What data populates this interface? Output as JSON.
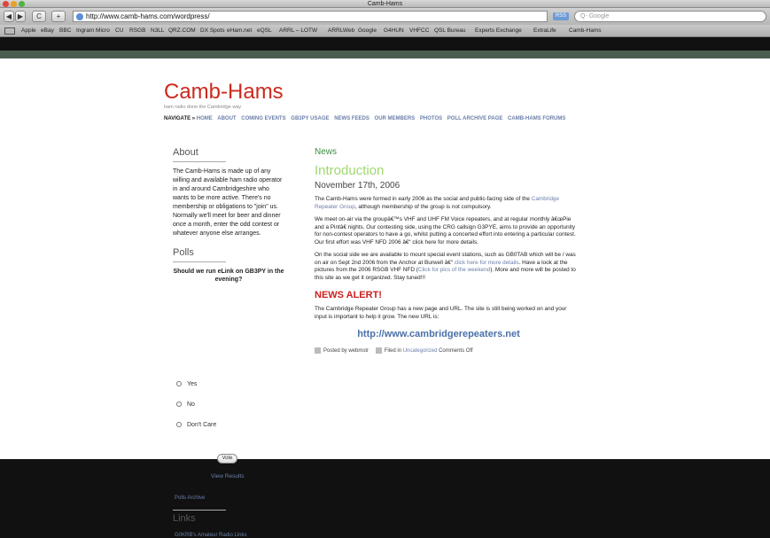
{
  "window": {
    "title": "Camb-Hams"
  },
  "toolbar": {
    "back": "◀",
    "forward": "▶",
    "reload": "C",
    "add": "+",
    "url": "http://www.camb-hams.com/wordpress/",
    "rss": "RSS",
    "search_placeholder": "Q- Google"
  },
  "bookmarks": [
    "Apple",
    "eBay",
    "BBC",
    "Ingram Micro",
    "CU",
    "RSGB",
    "N3LL",
    "QRZ.COM",
    "DX Spots",
    "eHam.net",
    "eQSL",
    "ARRL – LOTW",
    "ARRLWeb",
    "Google",
    "G4HUN",
    "VHFCC",
    "QSL Bureau",
    "Experts Exchange",
    "ExtraLife",
    "Camb-Hams"
  ],
  "site": {
    "title": "Camb-Hams",
    "tagline": "ham radio done the Cambridge way",
    "nav_label": "NAVIGATE »",
    "nav": [
      "HOME",
      "ABOUT",
      "COMING EVENTS",
      "GB3PY USAGE",
      "NEWS FEEDS",
      "OUR MEMBERS",
      "PHOTOS",
      "POLL ARCHIVE PAGE",
      "CAMB-HAMS FORUMS"
    ]
  },
  "sidebar": {
    "about_heading": "About",
    "about_text": "The Camb-Hams is made up of any willing and available ham radio operator in and around Cambridgeshire who wants to be more active. There's no membership or obligations to \"join\" us. Normally we'll meet for beer and dinner once a month, enter the odd contest or whatever anyone else arranges.",
    "polls_heading": "Polls",
    "poll_question": "Should we run eLink on GB3PY in the evening?",
    "options": [
      "Yes",
      "No",
      "Don't Care"
    ],
    "vote": "Vote",
    "view_results": "View Results",
    "polls_archive": "Polls Archive",
    "links_heading": "Links",
    "links": [
      "G0KRB's Amateur Radio Links"
    ]
  },
  "post": {
    "section": "News",
    "title": "Introduction",
    "date": "November 17th, 2006",
    "p1_a": "The Camb-Hams were formed in early 2006 as the social and public-facing side of the ",
    "p1_link": "Cambridge Repeater Group",
    "p1_b": ", although membership of the group is not compulsory.",
    "p2": "We meet on-air via the groupâ€™s VHF and UHF FM Voice repeaters, and at regular monthly â€œPie and a Pintâ€ nights. Our contesting side, using the CRG callsign G3PYE, aims to provide an opportunity for non-contest operators to have a go, whilst putting a concerted effort into entering a particular contest. Our first effort was VHF NFD 2006 â€“ click here for more details.",
    "p3_a": "On the social side we are available to mount special event stations, such as GB0TAB which will be / was on air on Sept 2nd 2006 from the Anchor at Burwell â€“ ",
    "p3_link1": "click here for more details",
    "p3_b": ". Have a look at the pictures from the 2006 RSGB VHF NFD (",
    "p3_link2": "Click for pics of the weekend",
    "p3_c": "). More and more will be posted to this site as we get it organized. Stay tuned!!!",
    "alert": "NEWS ALERT!",
    "p4": "The Cambridge Repeater Group has a new page and URL. The site is still being worked on and your input is important to help it grow. The new URL is:",
    "big_url": "http://www.cambridgerepeaters.net",
    "meta_posted": "Posted by webmstr",
    "meta_filed": "Filed in",
    "meta_category": "Uncategorized",
    "meta_comments": "Comments Off"
  }
}
